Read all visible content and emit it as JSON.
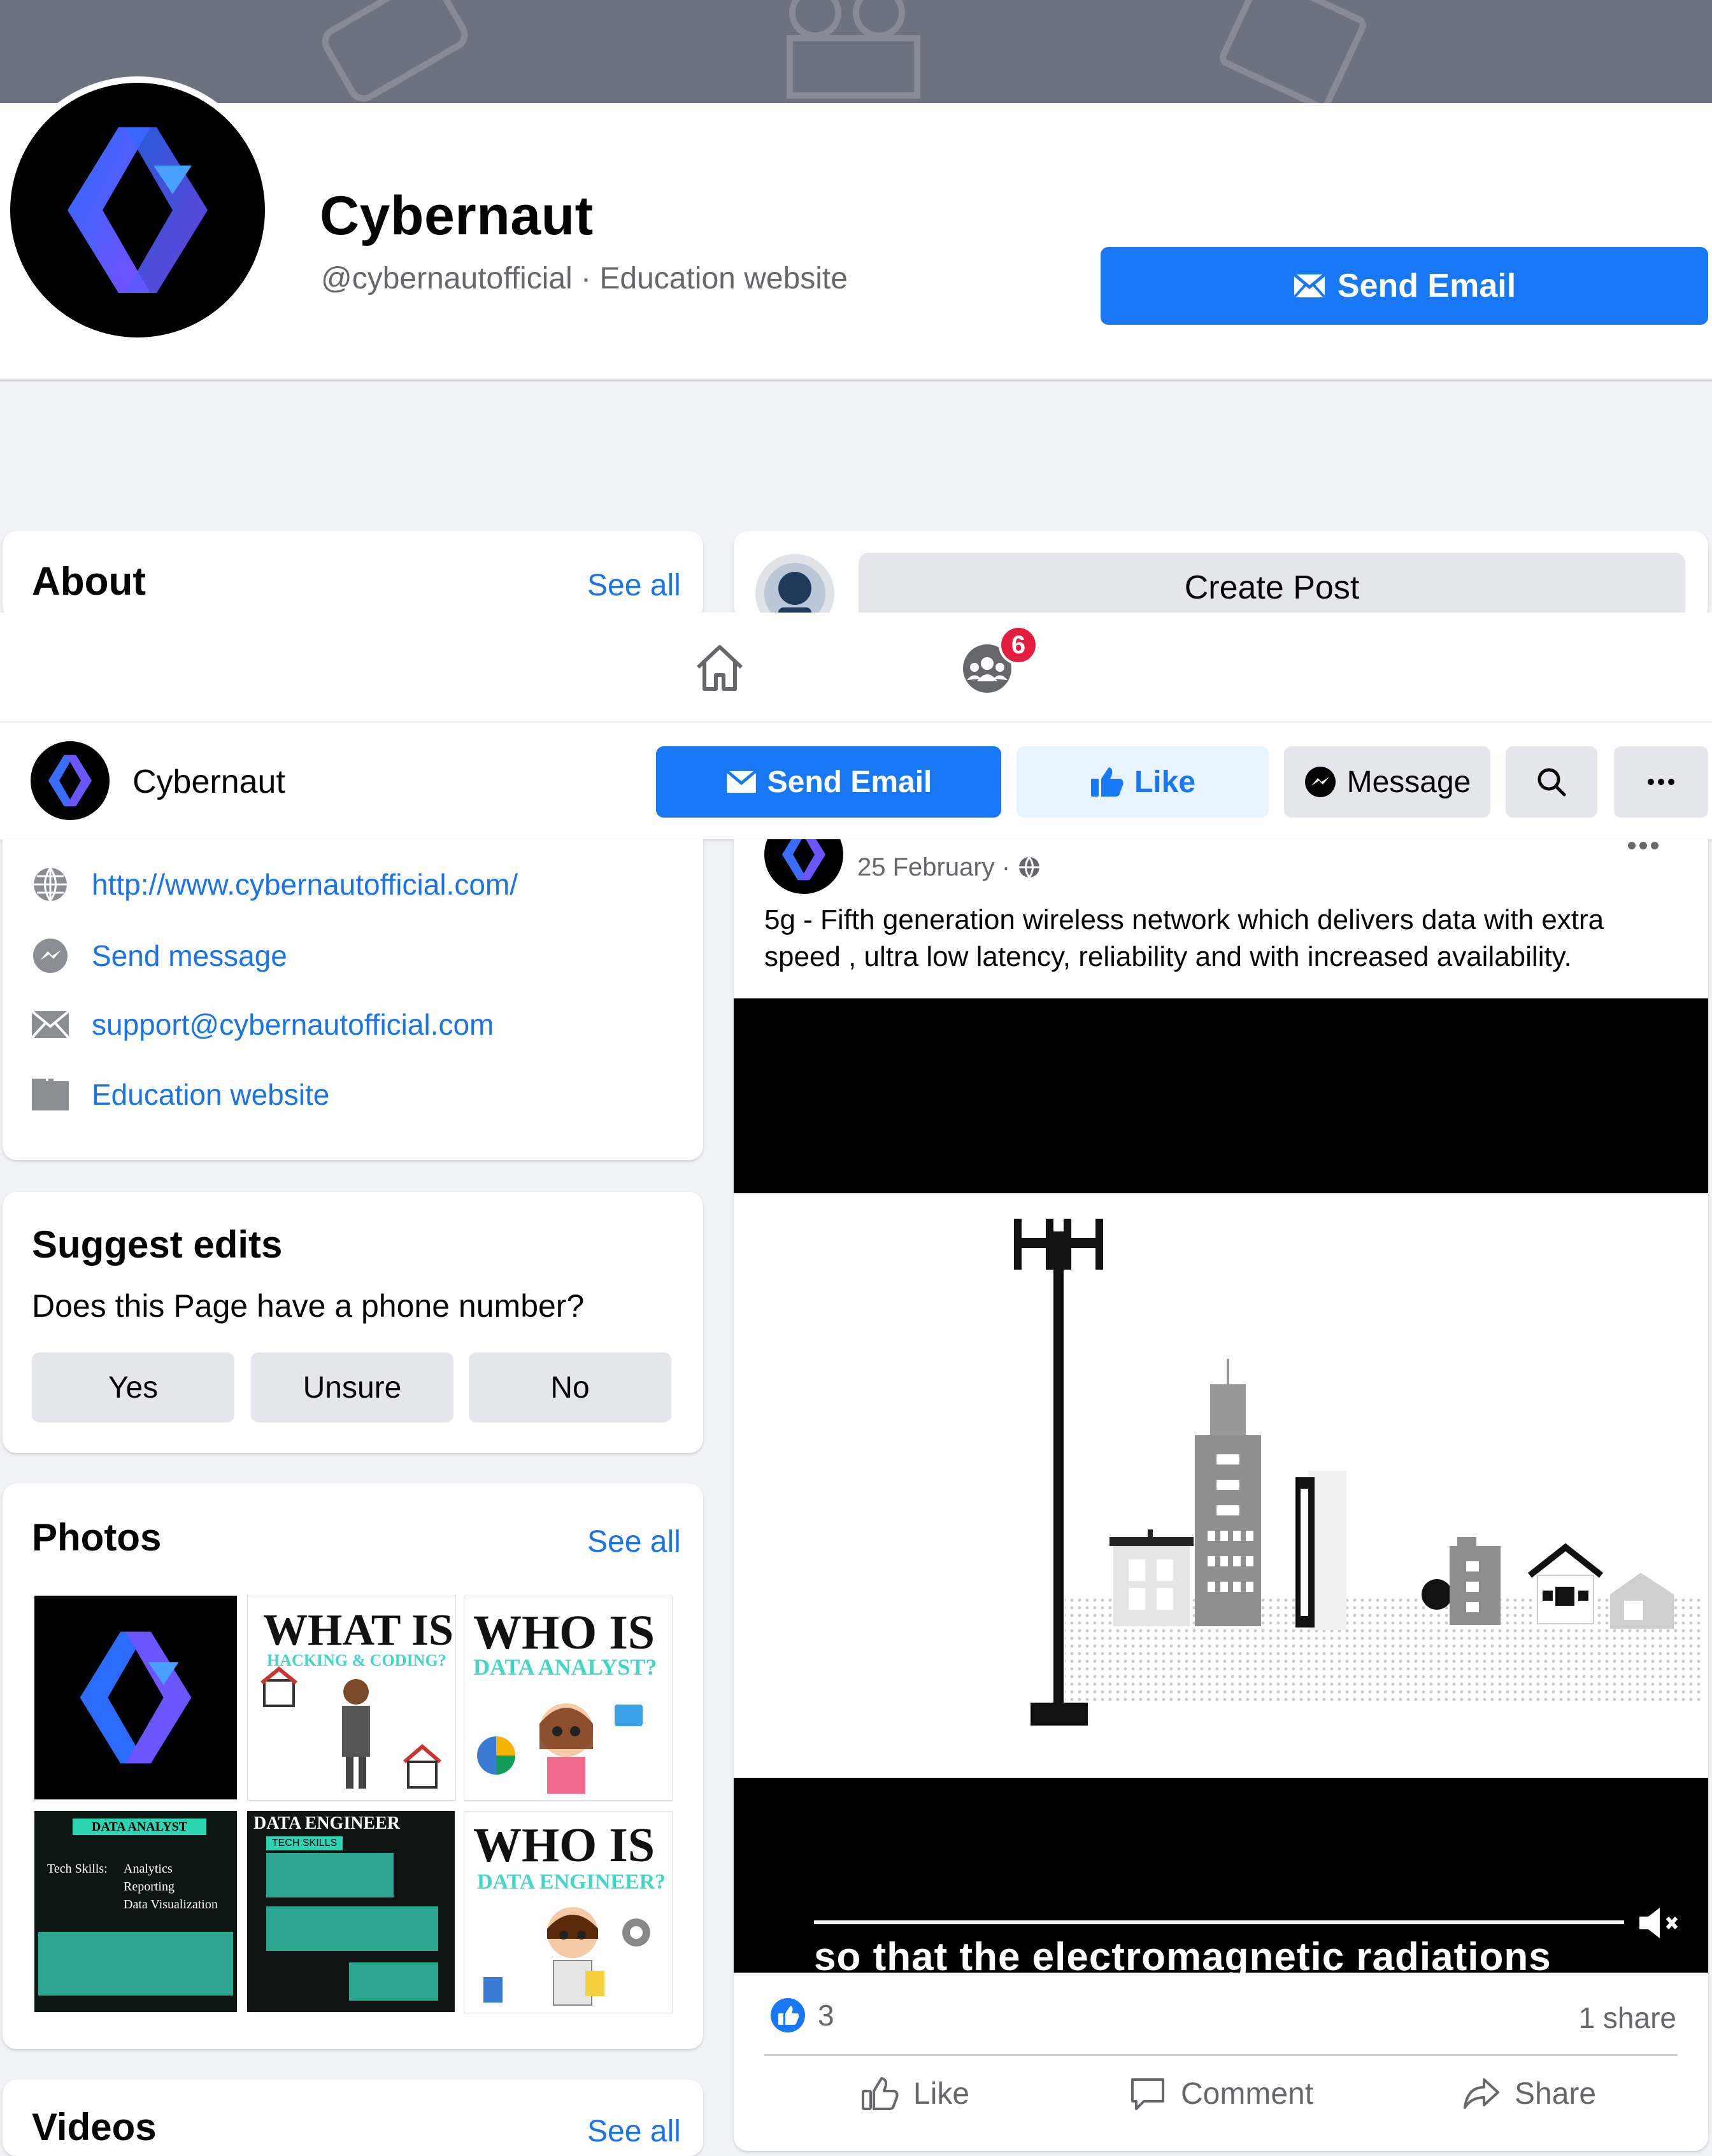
{
  "page": {
    "name": "Cybernaut",
    "handle_line": "@cybernautofficial · Education website",
    "send_email": "Send Email",
    "create_post": "Create Post"
  },
  "tabs": {
    "groups_badge": "6"
  },
  "sticky": {
    "name": "Cybernaut",
    "send_email": "Send Email",
    "like": "Like",
    "message": "Message"
  },
  "about": {
    "title": "About",
    "see_all": "See all",
    "items": [
      {
        "icon": "globe-icon",
        "text": "http://www.cybernautofficial.com/"
      },
      {
        "icon": "messenger-icon",
        "text": "Send message"
      },
      {
        "icon": "mail-icon",
        "text": "support@cybernautofficial.com"
      },
      {
        "icon": "category-icon",
        "text": "Education website"
      }
    ]
  },
  "suggest": {
    "title": "Suggest edits",
    "question": "Does this Page have a phone number?",
    "options": [
      "Yes",
      "Unsure",
      "No"
    ]
  },
  "photos": {
    "title": "Photos",
    "see_all": "See all",
    "thumbs": [
      {
        "kind": "logo"
      },
      {
        "headline": "WHAT IS",
        "sub": "HACKING & CODING?"
      },
      {
        "headline": "WHO IS",
        "sub": "DATA ANALYST?"
      },
      {
        "headline": "DATA ANALYST",
        "items": [
          "Tech Skills:",
          "Analytics",
          "Reporting",
          "Data Visualization"
        ]
      },
      {
        "headline": "DATA ENGINEER",
        "sub": "TECH SKILLS"
      },
      {
        "headline": "WHO IS",
        "sub": "DATA ENGINEER?"
      }
    ]
  },
  "videos": {
    "title": "Videos",
    "see_all": "See all"
  },
  "post": {
    "date": "25 February · ",
    "text": "5g - Fifth generation wireless network which delivers data with extra speed , ultra low latency, reliability and with increased availability.",
    "caption": "so that the electromagnetic radiations",
    "reaction_count": "3",
    "shares": "1 share",
    "actions": {
      "like": "Like",
      "comment": "Comment",
      "share": "Share"
    }
  },
  "colors": {
    "brand_blue": "#1877f2",
    "link_blue": "#1a73e8",
    "badge_red": "#e41e3f",
    "muted": "#65676b"
  }
}
